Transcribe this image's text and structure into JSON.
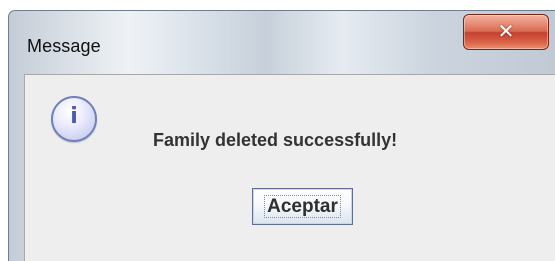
{
  "window": {
    "title": "Message"
  },
  "icons": {
    "info": "info-icon",
    "close": "close-icon"
  },
  "message": {
    "text": "Family deleted successfully!"
  },
  "buttons": {
    "accept_label": "Aceptar"
  },
  "colors": {
    "close_button": "#d76a52",
    "info_icon": "#4b5ba8",
    "dialog_background": "#eeeeee"
  }
}
